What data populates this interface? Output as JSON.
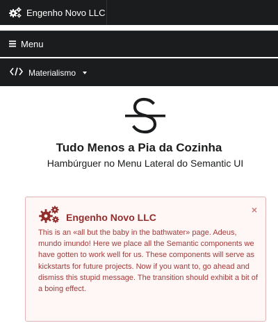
{
  "topbar": {
    "brand_label": "Engenho Novo LLC",
    "brand_icon": "cogs-icon"
  },
  "menubar": {
    "menu_label": "Menu",
    "menu_icon": "hamburger-icon"
  },
  "dropbar": {
    "label": "Materialismo",
    "icon": "code-icon"
  },
  "hero": {
    "logo_icon": "strikethrough-s-icon",
    "title": "Tudo Menos a Pia da Cozinha",
    "subtitle": "Hambúrguer no Menu Lateral do Semantic UI"
  },
  "message": {
    "header": "Engenho Novo LLC",
    "close_glyph": "×",
    "body": "This is an «all but the baby in the bathwater» page. Adeus, mundo imundo! Here we place all the Semantic components we have gotten to work well for us. These components will serve as kickstarts for future projects. Now if you want to, go ahead and dismiss this stupid message. The transition should exhibit a bit of a boing effect."
  },
  "colors": {
    "bar_background": "#1b1c1d",
    "message_background": "#fff6f6",
    "message_border": "#e0b4b4",
    "message_header": "#912d2b",
    "message_text": "#9f3a38"
  }
}
